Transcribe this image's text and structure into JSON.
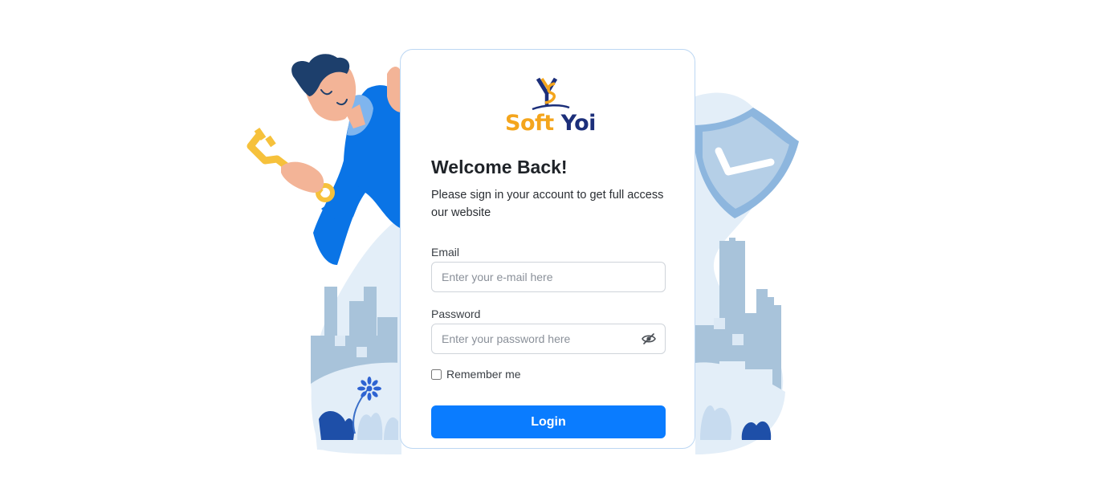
{
  "brand": {
    "soft": "Soft",
    "yoi": "Yoi"
  },
  "heading": "Welcome Back!",
  "subtitle": "Please sign in your account to get full access our website",
  "email": {
    "label": "Email",
    "placeholder": "Enter your e-mail here",
    "value": ""
  },
  "password": {
    "label": "Password",
    "placeholder": "Enter your password here",
    "value": ""
  },
  "remember": {
    "label": "Remember me",
    "checked": false
  },
  "login_button": "Login",
  "icons": [
    "key-icon",
    "shield-check-icon",
    "eye-off-icon",
    "flower-icon"
  ],
  "colors": {
    "primary": "#0a7cff",
    "brand_orange": "#f4a51c",
    "brand_navy": "#1c2f7a",
    "illustration_light": "#dce9f5",
    "illustration_mid": "#a9c4dc"
  }
}
